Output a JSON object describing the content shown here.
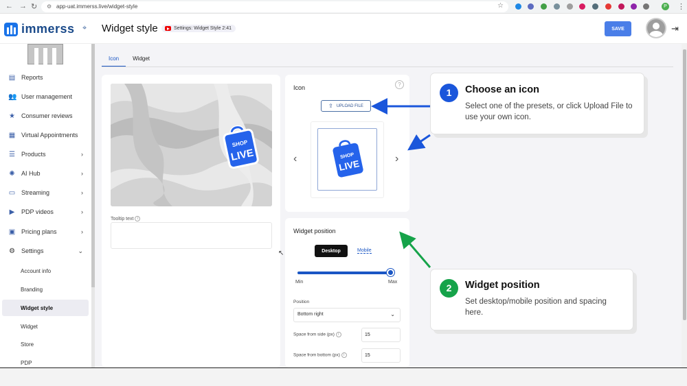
{
  "browser": {
    "url": "app-uat.immerss.live/widget-style",
    "extension_avatar": "P"
  },
  "header": {
    "brand": "immerss",
    "page_title": "Widget style",
    "video_badge": "Settings: Widget Style 2:41",
    "save_label": "SAVE"
  },
  "sidebar": {
    "items": [
      {
        "label": "Reports",
        "icon": "reports-icon",
        "chevron": false
      },
      {
        "label": "User management",
        "icon": "users-icon",
        "chevron": false
      },
      {
        "label": "Consumer reviews",
        "icon": "star-icon",
        "chevron": false
      },
      {
        "label": "Virtual Appointments",
        "icon": "calendar-icon",
        "chevron": false
      },
      {
        "label": "Products",
        "icon": "list-icon",
        "chevron": true
      },
      {
        "label": "AI Hub",
        "icon": "ai-icon",
        "chevron": true
      },
      {
        "label": "Streaming",
        "icon": "monitor-icon",
        "chevron": true
      },
      {
        "label": "PDP videos",
        "icon": "video-icon",
        "chevron": true
      },
      {
        "label": "Pricing plans",
        "icon": "price-icon",
        "chevron": true
      },
      {
        "label": "Settings",
        "icon": "gear-icon",
        "chevron": true
      }
    ],
    "sub_items": [
      "Account info",
      "Branding",
      "Widget style",
      "Widget",
      "Store",
      "PDP"
    ],
    "active_sub": "Widget style"
  },
  "tabs": [
    "Icon",
    "Widget"
  ],
  "preview": {
    "tooltip_label": "Tooltip text",
    "tooltip_value": ""
  },
  "icon_panel": {
    "title": "Icon",
    "upload_label": "UPLOAD FILE"
  },
  "shop_icon": {
    "top_text": "SHOP",
    "bottom_text": "LIVE",
    "color": "#2563eb"
  },
  "widget_position": {
    "title": "Widget position",
    "desktop_label": "Desktop",
    "mobile_label": "Mobile",
    "slider_min": "Min",
    "slider_max": "Max",
    "slider_value": 0.95,
    "position_label": "Position",
    "position_value": "Bottom right",
    "side_label": "Space from side (px)",
    "side_value": "15",
    "bottom_label": "Space from bottom (px)",
    "bottom_value": "15"
  },
  "callouts": [
    {
      "number": "1",
      "title": "Choose an icon",
      "text": "Select one of the presets, or click Upload File to use your own icon.",
      "color": "#1a56db"
    },
    {
      "number": "2",
      "title": "Widget position",
      "text": "Set desktop/mobile position and spacing here.",
      "color": "#16a34a"
    }
  ]
}
